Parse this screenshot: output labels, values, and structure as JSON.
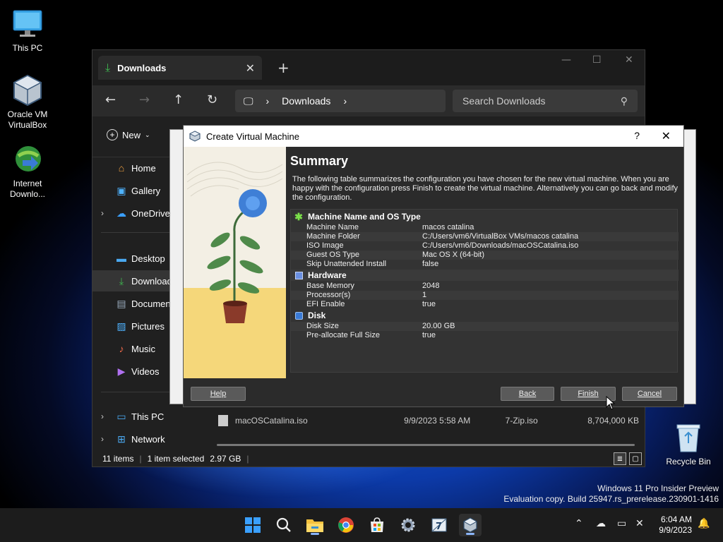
{
  "desktop": {
    "icons": [
      {
        "label": "This PC",
        "icon": "monitor-icon"
      },
      {
        "label": "Oracle VM VirtualBox",
        "icon": "virtualbox-icon"
      },
      {
        "label": "Internet Downlo...",
        "icon": "idm-icon"
      },
      {
        "label": "Recycle Bin",
        "icon": "recycle-bin-icon"
      }
    ],
    "watermark_line1": "Windows 11 Pro Insider Preview",
    "watermark_line2": "Evaluation copy. Build 25947.rs_prerelease.230901-1416"
  },
  "explorer": {
    "tab_label": "Downloads",
    "tab_close": "✕",
    "tab_add": "+",
    "address_segment": "Downloads",
    "search_placeholder": "Search Downloads",
    "new_label": "New",
    "nav": {
      "home": "Home",
      "gallery": "Gallery",
      "onedrive": "OneDrive",
      "desktop": "Desktop",
      "downloads": "Downloads",
      "documents": "Documents",
      "pictures": "Pictures",
      "music": "Music",
      "videos": "Videos",
      "this_pc": "This PC",
      "network": "Network"
    },
    "file": {
      "name": "macOSCatalina.iso",
      "date": "9/9/2023 5:58 AM",
      "type": "7-Zip.iso",
      "size": "8,704,000 KB"
    },
    "status": {
      "items": "11 items",
      "selected": "1 item selected",
      "size": "2.97 GB"
    }
  },
  "dialog": {
    "title": "Create Virtual Machine",
    "help_glyph": "?",
    "close_glyph": "✕",
    "summary_title": "Summary",
    "description": "The following table summarizes the configuration you have chosen for the new virtual machine. When you are happy with the configuration press Finish to create the virtual machine. Alternatively you can go back and modify the configuration.",
    "sections": {
      "name_os": "Machine Name and OS Type",
      "hardware": "Hardware",
      "disk": "Disk"
    },
    "rows": {
      "machine_name": {
        "k": "Machine Name",
        "v": "macos catalina"
      },
      "machine_folder": {
        "k": "Machine Folder",
        "v": "C:/Users/vm6/VirtualBox VMs/macos catalina"
      },
      "iso_image": {
        "k": "ISO Image",
        "v": "C:/Users/vm6/Downloads/macOSCatalina.iso"
      },
      "guest_os": {
        "k": "Guest OS Type",
        "v": "Mac OS X (64-bit)"
      },
      "skip_unattended": {
        "k": "Skip Unattended Install",
        "v": "false"
      },
      "base_memory": {
        "k": "Base Memory",
        "v": "2048"
      },
      "processors": {
        "k": "Processor(s)",
        "v": "1"
      },
      "efi": {
        "k": "EFI Enable",
        "v": "true"
      },
      "disk_size": {
        "k": "Disk Size",
        "v": "20.00 GB"
      },
      "preallocate": {
        "k": "Pre-allocate Full Size",
        "v": "true"
      }
    },
    "buttons": {
      "help": "Help",
      "back": "Back",
      "finish": "Finish",
      "cancel": "Cancel"
    }
  },
  "taskbar": {
    "time": "6:04 AM",
    "date": "9/9/2023",
    "apps": [
      "start-icon",
      "search-icon",
      "file-explorer-icon",
      "chrome-icon",
      "store-icon",
      "settings-icon",
      "7zip-icon",
      "virtualbox-icon"
    ]
  },
  "colors": {
    "accent_blue": "#0078d4",
    "dialog_bg": "#2b2b2b",
    "explorer_bg": "#202020"
  }
}
